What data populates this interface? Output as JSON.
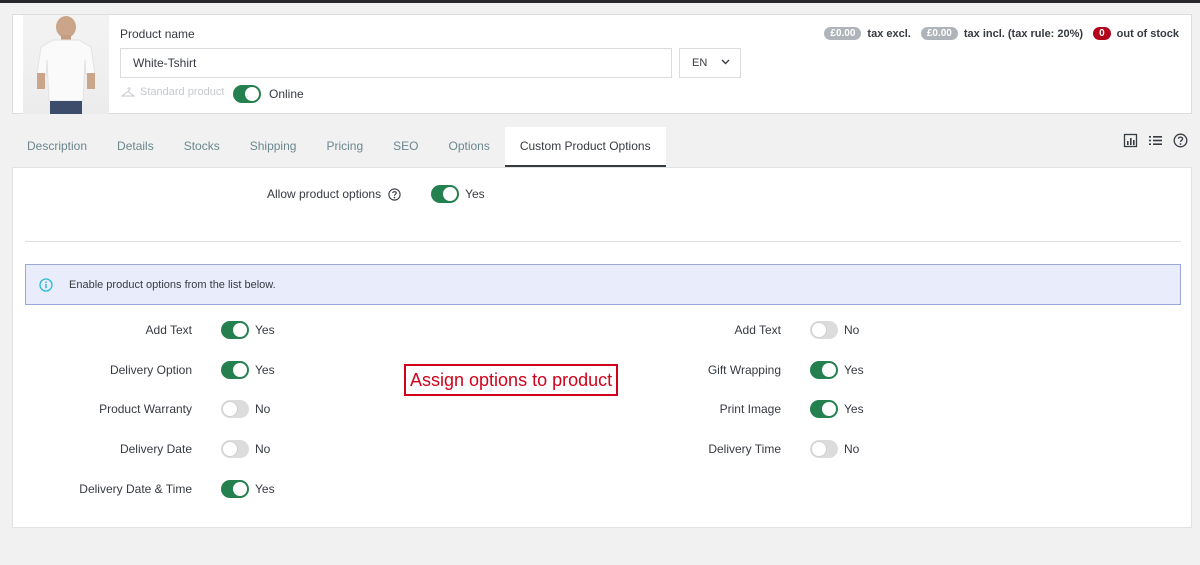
{
  "header": {
    "product_name_label": "Product name",
    "product_name_value": "White-Tshirt",
    "language": "EN",
    "product_type": "Standard product",
    "online_label": "Online",
    "online_on": true,
    "price_excl": "£0.00",
    "tax_excl_label": "tax excl.",
    "price_incl": "£0.00",
    "tax_incl_label": "tax incl. (tax rule: 20%)",
    "stock_count": "0",
    "stock_label": "out of stock"
  },
  "tabs": [
    {
      "label": "Description"
    },
    {
      "label": "Details"
    },
    {
      "label": "Stocks"
    },
    {
      "label": "Shipping"
    },
    {
      "label": "Pricing"
    },
    {
      "label": "SEO"
    },
    {
      "label": "Options"
    },
    {
      "label": "Custom Product Options",
      "active": true
    }
  ],
  "tab_icons": [
    "chart-icon",
    "list-icon",
    "help-icon"
  ],
  "allow": {
    "label": "Allow product options",
    "value": "Yes",
    "on": true
  },
  "info_text": "Enable product options from the list below.",
  "options_left": [
    {
      "label": "Add Text",
      "value": "Yes",
      "on": true
    },
    {
      "label": "Delivery Option",
      "value": "Yes",
      "on": true
    },
    {
      "label": "Product Warranty",
      "value": "No",
      "on": false
    },
    {
      "label": "Delivery Date",
      "value": "No",
      "on": false
    },
    {
      "label": "Delivery Date & Time",
      "value": "Yes",
      "on": true
    }
  ],
  "options_right": [
    {
      "label": "Add Text",
      "value": "No",
      "on": false
    },
    {
      "label": "Gift Wrapping",
      "value": "Yes",
      "on": true
    },
    {
      "label": "Print Image",
      "value": "Yes",
      "on": true
    },
    {
      "label": "Delivery Time",
      "value": "No",
      "on": false
    }
  ],
  "callout_text": "Assign options to product",
  "colors": {
    "toggle_on": "#24804e",
    "toggle_off": "#dcdcdc",
    "callout": "#d0021b",
    "info_bg": "#e9edfb"
  }
}
